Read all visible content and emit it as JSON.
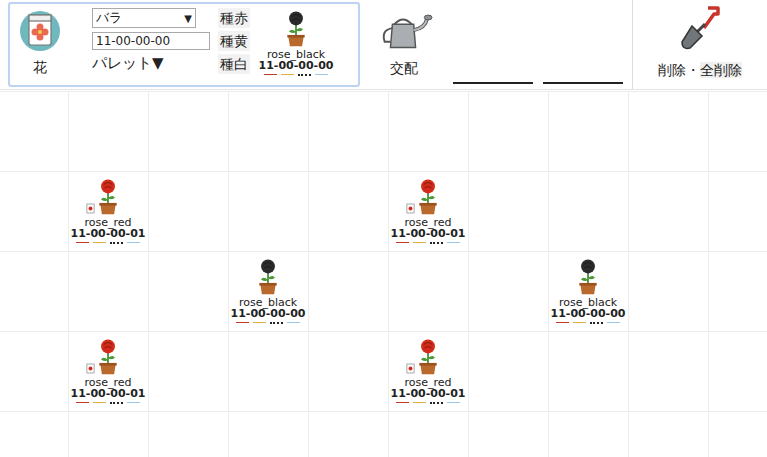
{
  "toolbar": {
    "flower_tool": {
      "label": "花",
      "species": "バラ",
      "species_arrow": "▼",
      "gene_code": "11-00-00-00",
      "palette": "パレット▼",
      "seed_buttons": [
        {
          "label": "種赤"
        },
        {
          "label": "種黄"
        },
        {
          "label": "種白"
        }
      ],
      "preview": {
        "name": "rose_black",
        "code": "11-00-00-00",
        "color": "#2b2b2b"
      }
    },
    "cross_tool": {
      "label": "交配"
    },
    "fields": [
      {
        "value": ""
      },
      {
        "value": ""
      }
    ],
    "delete_tool": {
      "label": "削除・",
      "label_all": "全削除"
    }
  },
  "gene_marks": [
    {
      "color": "#c0392b",
      "kind": "line"
    },
    {
      "color": "#e0b040",
      "kind": "line"
    },
    {
      "color": "#222222",
      "kind": "dots"
    },
    {
      "color": "#9cc8e8",
      "kind": "line"
    }
  ],
  "flowers": [
    {
      "name": "rose_red",
      "code": "11-00-00-01",
      "color": "#d42a1a",
      "seed": true,
      "row": 2,
      "col": 2
    },
    {
      "name": "rose_red",
      "code": "11-00-00-01",
      "color": "#d42a1a",
      "seed": true,
      "row": 2,
      "col": 6
    },
    {
      "name": "rose_black",
      "code": "11-00-00-00",
      "color": "#2b2b2b",
      "seed": false,
      "row": 3,
      "col": 4
    },
    {
      "name": "rose_black",
      "code": "11-00-00-00",
      "color": "#2b2b2b",
      "seed": false,
      "row": 3,
      "col": 8
    },
    {
      "name": "rose_red",
      "code": "11-00-00-01",
      "color": "#d42a1a",
      "seed": true,
      "row": 4,
      "col": 2
    },
    {
      "name": "rose_red",
      "code": "11-00-00-01",
      "color": "#d42a1a",
      "seed": true,
      "row": 4,
      "col": 6
    }
  ]
}
